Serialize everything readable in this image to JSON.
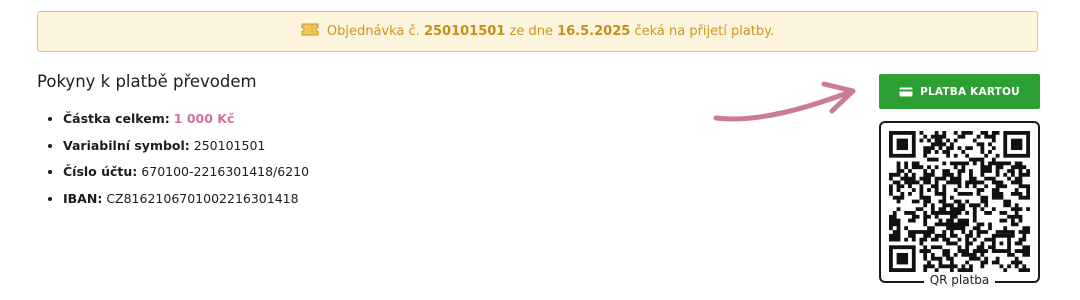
{
  "notice": {
    "prefix": "Objednávka č.",
    "order_number": "250101501",
    "middle": "ze dne",
    "date": "16.5.2025",
    "suffix": "čeká na přijetí platby.",
    "icon": "ticket-icon"
  },
  "instructions": {
    "title": "Pokyny k platbě převodem",
    "items": [
      {
        "label": "Částka celkem:",
        "value": "1 000 Kč"
      },
      {
        "label": "Variabilní symbol:",
        "value": "250101501"
      },
      {
        "label": "Číslo účtu:",
        "value": "670100-2216301418/6210"
      },
      {
        "label": "IBAN:",
        "value": "CZ8162106701002216301418"
      }
    ]
  },
  "payment": {
    "card_button_label": "PLATBA KARTOU",
    "card_icon": "credit-card-icon",
    "qr_caption": "QR platba"
  },
  "colors": {
    "notice_bg": "#fcf4dd",
    "notice_border": "#e6c46a",
    "notice_text": "#c99720",
    "amount": "#d0709e",
    "button": "#2ca032",
    "arrow": "#c97b97"
  }
}
